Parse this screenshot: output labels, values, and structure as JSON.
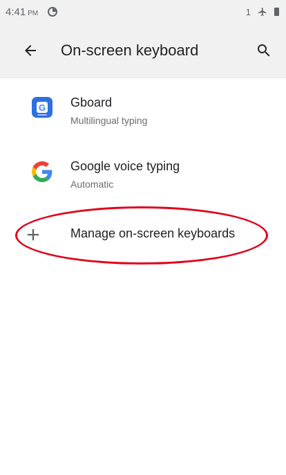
{
  "status_bar": {
    "time": "4:41",
    "ampm": "PM",
    "sim": "1",
    "icons": [
      "data-saver-icon",
      "airplane-icon",
      "battery-icon"
    ]
  },
  "app_bar": {
    "title": "On-screen keyboard",
    "back_icon": "arrow-back-icon",
    "search_icon": "search-icon"
  },
  "items": [
    {
      "title": "Gboard",
      "subtitle": "Multilingual typing",
      "icon": "gboard-icon"
    },
    {
      "title": "Google voice typing",
      "subtitle": "Automatic",
      "icon": "google-g-icon"
    },
    {
      "title": "Manage on-screen keyboards",
      "icon": "plus-icon"
    }
  ],
  "colors": {
    "header_bg": "#f1f1f1",
    "annotation": "#e0001b",
    "gboard": "#2f6fe0"
  }
}
